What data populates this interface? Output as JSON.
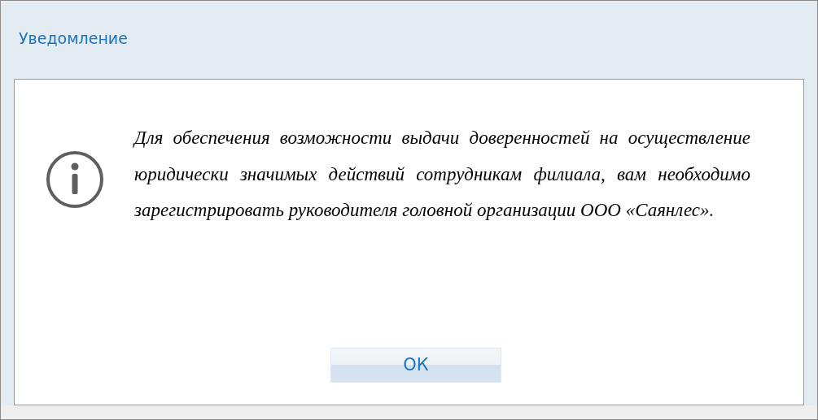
{
  "dialog": {
    "title": "Уведомление",
    "message": "Для обеспечения возможности выдачи доверенностей на осуществление юридически значимых действий сотрудникам филиала, вам необходимо зарегистрировать руководителя головной организации ООО «Саянлес».",
    "buttons": [
      "ОК"
    ]
  }
}
